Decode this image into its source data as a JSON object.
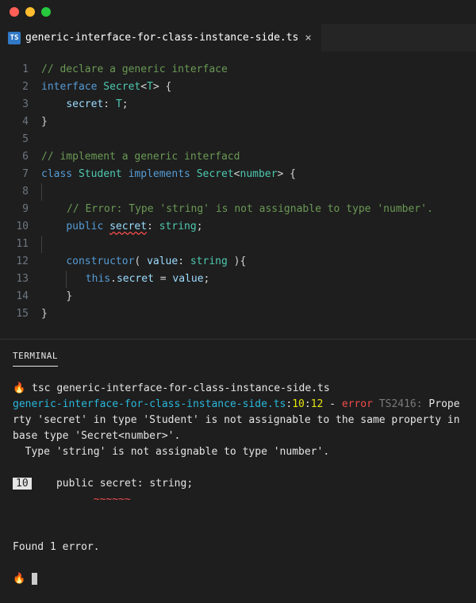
{
  "tab": {
    "icon_label": "TS",
    "filename": "generic-interface-for-class-instance-side.ts",
    "close_glyph": "×"
  },
  "terminal_tab_label": "TERMINAL",
  "code": {
    "l1": "// declare a generic interface",
    "l2a": "interface",
    "l2b": "Secret",
    "l2c": "<",
    "l2d": "T",
    "l2e": ">",
    "l2f": " {",
    "l3a": "secret",
    "l3b": ":",
    "l3c": "T",
    "l3d": ";",
    "l4": "}",
    "l6": "// implement a generic interfacd",
    "l7a": "class",
    "l7b": "Student",
    "l7c": "implements",
    "l7d": "Secret",
    "l7e": "<",
    "l7f": "number",
    "l7g": ">",
    "l7h": " {",
    "l9": "// Error: Type 'string' is not assignable to type 'number'.",
    "l10a": "public",
    "l10b": "secret",
    "l10c": ":",
    "l10d": "string",
    "l10e": ";",
    "l12a": "constructor",
    "l12b": "(",
    "l12c": "value",
    "l12d": ":",
    "l12e": "string",
    "l12f": " ){",
    "l13a": "this",
    "l13b": ".",
    "l13c": "secret",
    "l13d": " = ",
    "l13e": "value",
    "l13f": ";",
    "l14": "}",
    "l15": "}"
  },
  "gutter": {
    "1": "1",
    "2": "2",
    "3": "3",
    "4": "4",
    "5": "5",
    "6": "6",
    "7": "7",
    "8": "8",
    "9": "9",
    "10": "10",
    "11": "11",
    "12": "12",
    "13": "13",
    "14": "14",
    "15": "15"
  },
  "terminal": {
    "prompt1": "🔥 ",
    "cmd": "tsc generic-interface-for-class-instance-side.ts",
    "err_file": "generic-interface-for-class-instance-side.ts",
    "err_loc_colon": ":",
    "err_line": "10",
    "err_col": "12",
    "err_dash": " - ",
    "err_word": "error",
    "err_code": " TS2416: ",
    "err_msg": "Property 'secret' in type 'Student' is not assignable to the same property in base type 'Secret<number>'.",
    "err_sub": "  Type 'string' is not assignable to type 'number'.",
    "snippet_ln": "10",
    "snippet_code": "    public secret: string;",
    "snippet_underline": "           ~~~~~~",
    "found": "Found 1 error.",
    "prompt2": "🔥 "
  }
}
